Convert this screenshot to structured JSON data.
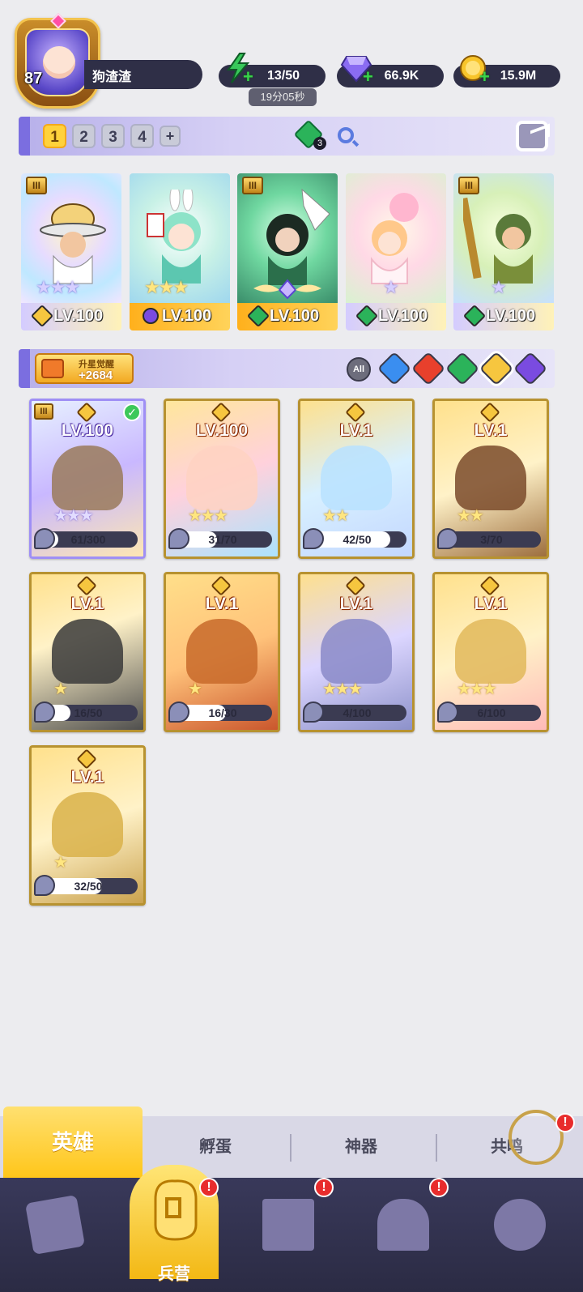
{
  "player": {
    "level": "87",
    "name": "狗渣渣"
  },
  "resources": {
    "energy": "13/50",
    "energy_timer": "19分05秒",
    "gems": "66.9K",
    "gold": "15.9M"
  },
  "team_bar": {
    "tabs": [
      "1",
      "2",
      "3",
      "4",
      "+"
    ],
    "active_tab": "1",
    "gem_badge_count": "3"
  },
  "team": [
    {
      "level": "LV.100",
      "element": "gold",
      "rank": "III",
      "stars": "★★★",
      "color": "#dcd4ff"
    },
    {
      "level": "LV.100",
      "element": "purple",
      "rank": "",
      "stars": "★★★",
      "color": "#ffd35a"
    },
    {
      "level": "LV.100",
      "element": "green",
      "rank": "III",
      "stars": "",
      "color": "#ffd35a"
    },
    {
      "level": "LV.100",
      "element": "green",
      "rank": "",
      "stars": "★",
      "color": "#dcd4ff"
    },
    {
      "level": "LV.100",
      "element": "green",
      "rank": "III",
      "stars": "★",
      "color": "#dcd4ff"
    }
  ],
  "filter_bar": {
    "awaken_title": "升星觉醒",
    "awaken_value": "+2684",
    "all_label": "All"
  },
  "heroes": [
    {
      "level": "LV.100",
      "shards": "61/300",
      "progress": 0.203,
      "selected": true,
      "rank": "III",
      "stars": "★★★"
    },
    {
      "level": "LV.100",
      "shards": "31/70",
      "progress": 0.443,
      "selected": false,
      "rank": "",
      "stars": "★★★"
    },
    {
      "level": "LV.1",
      "shards": "42/50",
      "progress": 0.84,
      "selected": false,
      "rank": "",
      "stars": "★★"
    },
    {
      "level": "LV.1",
      "shards": "3/70",
      "progress": 0.043,
      "selected": false,
      "rank": "",
      "stars": "★★"
    },
    {
      "level": "LV.1",
      "shards": "16/50",
      "progress": 0.32,
      "selected": false,
      "rank": "",
      "stars": "★"
    },
    {
      "level": "LV.1",
      "shards": "16/30",
      "progress": 0.533,
      "selected": false,
      "rank": "",
      "stars": "★"
    },
    {
      "level": "LV.1",
      "shards": "4/100",
      "progress": 0.04,
      "selected": false,
      "rank": "",
      "stars": "★★★"
    },
    {
      "level": "LV.1",
      "shards": "6/100",
      "progress": 0.06,
      "selected": false,
      "rank": "",
      "stars": "★★★"
    },
    {
      "level": "LV.1",
      "shards": "32/50",
      "progress": 0.64,
      "selected": false,
      "rank": "",
      "stars": "★"
    }
  ],
  "subtabs": [
    "英雄",
    "孵蛋",
    "神器",
    "共鸣"
  ],
  "bottom_nav": {
    "active_label": "兵营"
  }
}
